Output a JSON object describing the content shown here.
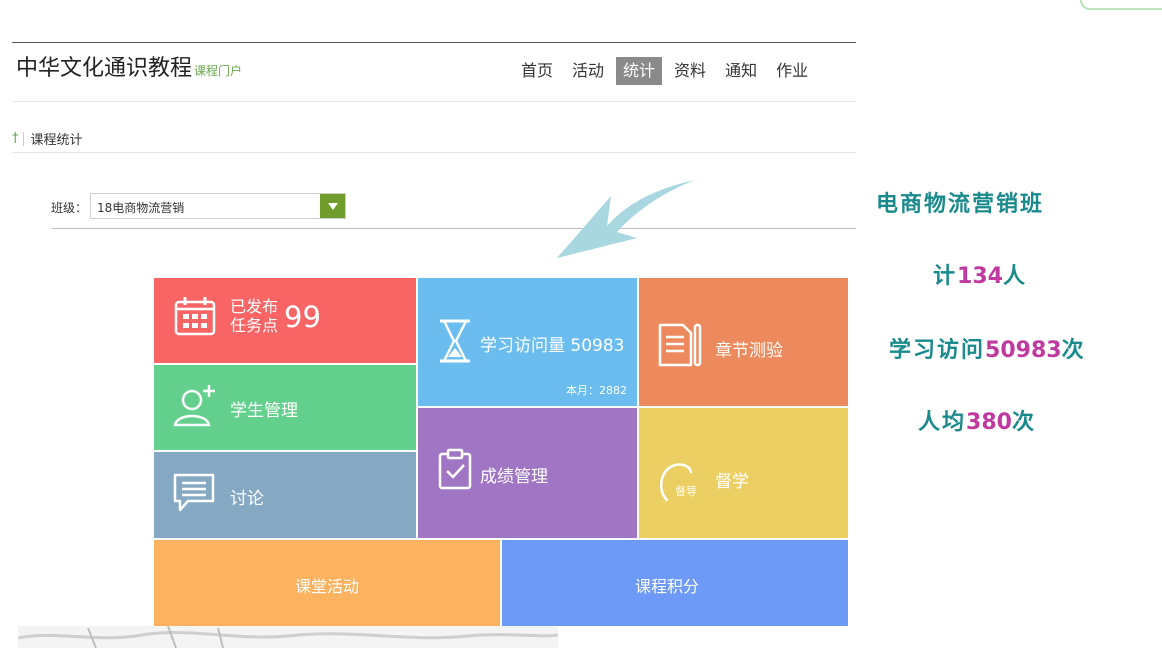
{
  "header": {
    "title": "中华文化通识教程",
    "subtitle": "课程门户",
    "nav": [
      {
        "label": "首页",
        "active": false
      },
      {
        "label": "活动",
        "active": false
      },
      {
        "label": "统计",
        "active": true
      },
      {
        "label": "资料",
        "active": false
      },
      {
        "label": "通知",
        "active": false
      },
      {
        "label": "作业",
        "active": false
      }
    ]
  },
  "breadcrumb": {
    "label": "课程统计"
  },
  "filter": {
    "class_label": "班级：",
    "class_value": "18电商物流营销"
  },
  "tiles": {
    "tasks": {
      "line1": "已发布",
      "line2": "任务点",
      "count": "99"
    },
    "students": {
      "label": "学生管理"
    },
    "discuss": {
      "label": "讨论"
    },
    "visits": {
      "label": "学习访问量 50983",
      "month": "本月：2882"
    },
    "quiz": {
      "label": "章节测验"
    },
    "grades": {
      "label": "成绩管理"
    },
    "supervise": {
      "label": "督学",
      "icon_text": "督导"
    },
    "class_activity": {
      "label": "课堂活动"
    },
    "points": {
      "label": "课程积分"
    }
  },
  "annotations": {
    "class_name": "电商物流营销班",
    "total_prefix": "计",
    "total_num": "134",
    "total_suffix": "人",
    "visits_prefix": "学习访问",
    "visits_num": "50983",
    "visits_suffix": "次",
    "avg_prefix": "人均",
    "avg_num": "380",
    "avg_suffix": "次"
  },
  "colors": {
    "tasks": "#f96565",
    "students": "#63d08e",
    "discuss": "#85a8c3",
    "visits": "#6bbcef",
    "quiz": "#ec8a5e",
    "grades": "#a075c3",
    "supervise": "#eccf63",
    "class_activity": "#fcb25f",
    "points": "#6c9af6",
    "annotation": "#1a8a8c",
    "annotation_number": "#c0399f",
    "accent": "#6aa84f"
  },
  "icons": [
    "calendar-icon",
    "user-add-icon",
    "chat-icon",
    "hourglass-icon",
    "document-icon",
    "clipboard-check-icon",
    "supervise-icon",
    "cross-icon",
    "dropdown-arrow-icon"
  ]
}
